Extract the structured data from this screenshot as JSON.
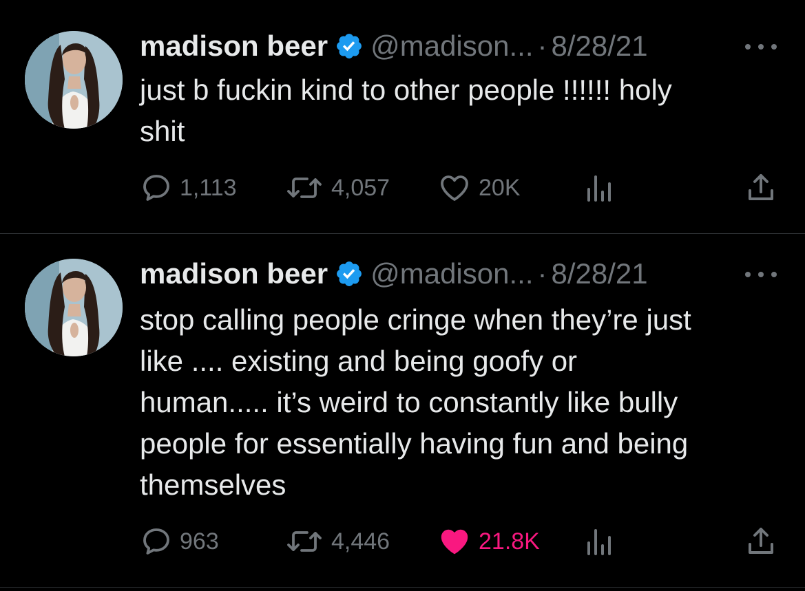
{
  "tweets": [
    {
      "display_name": "madison beer",
      "handle": "@madison...",
      "separator": "·",
      "date": "8/28/21",
      "text": "just b fuckin kind to other people !!!!!! holy\nshit",
      "replies": "1,113",
      "retweets": "4,057",
      "likes": "20K",
      "liked": false
    },
    {
      "display_name": "madison beer",
      "handle": "@madison...",
      "separator": "·",
      "date": "8/28/21",
      "text": "stop calling people cringe when they’re just\nlike .... existing and being goofy or\nhuman..... it’s weird to constantly like bully\npeople for essentially having fun and being\nthemselves",
      "replies": "963",
      "retweets": "4,446",
      "likes": "21.8K",
      "liked": true
    }
  ],
  "icons": {
    "verified": "verified-badge-icon",
    "more": "more-options-icon",
    "reply": "reply-icon",
    "retweet": "retweet-icon",
    "like": "heart-icon",
    "views": "views-icon",
    "share": "share-icon"
  },
  "colors": {
    "background": "#000000",
    "text": "#e7e9ea",
    "secondary": "#71767b",
    "verified": "#1d9bf0",
    "like_active": "#f91880",
    "divider": "#2f3336"
  }
}
